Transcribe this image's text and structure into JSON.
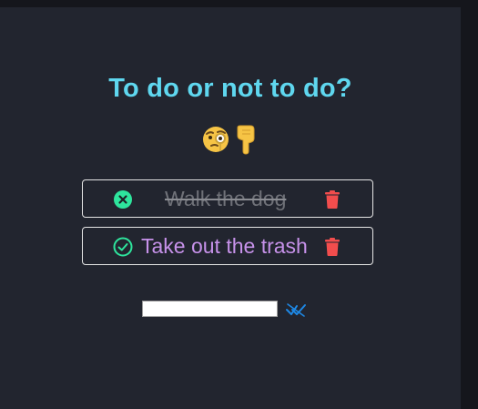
{
  "app": {
    "title": "To do or not to do?"
  },
  "header": {
    "emojis": [
      "monocle-face-emoji",
      "pointing-down-emoji"
    ]
  },
  "todos": [
    {
      "label": "Walk the dog",
      "done": true,
      "status_icon": "x-circle-icon",
      "delete_icon": "trash-icon"
    },
    {
      "label": "Take out the trash",
      "done": false,
      "status_icon": "check-circle-icon",
      "delete_icon": "trash-icon"
    }
  ],
  "new_todo": {
    "value": "",
    "placeholder": "",
    "submit_icon": "double-check-icon"
  },
  "colors": {
    "background": "#22252f",
    "title": "#5fd7ef",
    "done_status": "#2ee59d",
    "pending_text": "#c792ea",
    "delete": "#f24d4d",
    "submit": "#1e88e5"
  }
}
